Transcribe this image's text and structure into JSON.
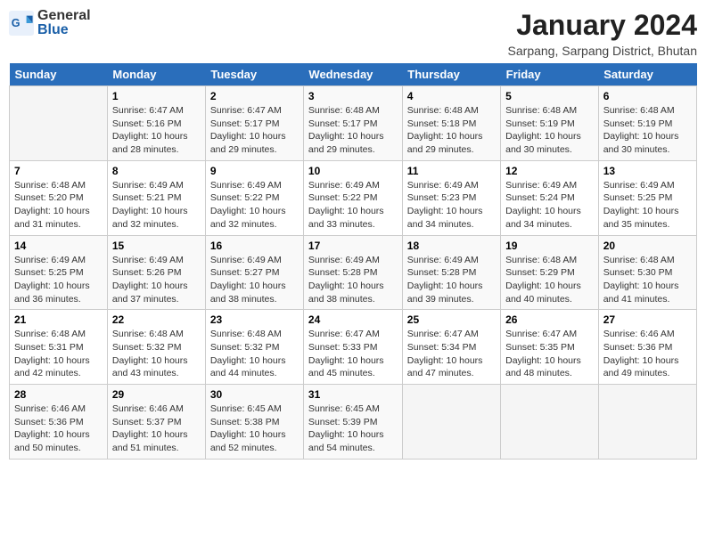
{
  "header": {
    "logo_general": "General",
    "logo_blue": "Blue",
    "month_year": "January 2024",
    "location": "Sarpang, Sarpang District, Bhutan"
  },
  "weekdays": [
    "Sunday",
    "Monday",
    "Tuesday",
    "Wednesday",
    "Thursday",
    "Friday",
    "Saturday"
  ],
  "weeks": [
    [
      {
        "day": "",
        "info": ""
      },
      {
        "day": "1",
        "info": "Sunrise: 6:47 AM\nSunset: 5:16 PM\nDaylight: 10 hours and 28 minutes."
      },
      {
        "day": "2",
        "info": "Sunrise: 6:47 AM\nSunset: 5:17 PM\nDaylight: 10 hours and 29 minutes."
      },
      {
        "day": "3",
        "info": "Sunrise: 6:48 AM\nSunset: 5:17 PM\nDaylight: 10 hours and 29 minutes."
      },
      {
        "day": "4",
        "info": "Sunrise: 6:48 AM\nSunset: 5:18 PM\nDaylight: 10 hours and 29 minutes."
      },
      {
        "day": "5",
        "info": "Sunrise: 6:48 AM\nSunset: 5:19 PM\nDaylight: 10 hours and 30 minutes."
      },
      {
        "day": "6",
        "info": "Sunrise: 6:48 AM\nSunset: 5:19 PM\nDaylight: 10 hours and 30 minutes."
      }
    ],
    [
      {
        "day": "7",
        "info": "Sunrise: 6:48 AM\nSunset: 5:20 PM\nDaylight: 10 hours and 31 minutes."
      },
      {
        "day": "8",
        "info": "Sunrise: 6:49 AM\nSunset: 5:21 PM\nDaylight: 10 hours and 32 minutes."
      },
      {
        "day": "9",
        "info": "Sunrise: 6:49 AM\nSunset: 5:22 PM\nDaylight: 10 hours and 32 minutes."
      },
      {
        "day": "10",
        "info": "Sunrise: 6:49 AM\nSunset: 5:22 PM\nDaylight: 10 hours and 33 minutes."
      },
      {
        "day": "11",
        "info": "Sunrise: 6:49 AM\nSunset: 5:23 PM\nDaylight: 10 hours and 34 minutes."
      },
      {
        "day": "12",
        "info": "Sunrise: 6:49 AM\nSunset: 5:24 PM\nDaylight: 10 hours and 34 minutes."
      },
      {
        "day": "13",
        "info": "Sunrise: 6:49 AM\nSunset: 5:25 PM\nDaylight: 10 hours and 35 minutes."
      }
    ],
    [
      {
        "day": "14",
        "info": "Sunrise: 6:49 AM\nSunset: 5:25 PM\nDaylight: 10 hours and 36 minutes."
      },
      {
        "day": "15",
        "info": "Sunrise: 6:49 AM\nSunset: 5:26 PM\nDaylight: 10 hours and 37 minutes."
      },
      {
        "day": "16",
        "info": "Sunrise: 6:49 AM\nSunset: 5:27 PM\nDaylight: 10 hours and 38 minutes."
      },
      {
        "day": "17",
        "info": "Sunrise: 6:49 AM\nSunset: 5:28 PM\nDaylight: 10 hours and 38 minutes."
      },
      {
        "day": "18",
        "info": "Sunrise: 6:49 AM\nSunset: 5:28 PM\nDaylight: 10 hours and 39 minutes."
      },
      {
        "day": "19",
        "info": "Sunrise: 6:48 AM\nSunset: 5:29 PM\nDaylight: 10 hours and 40 minutes."
      },
      {
        "day": "20",
        "info": "Sunrise: 6:48 AM\nSunset: 5:30 PM\nDaylight: 10 hours and 41 minutes."
      }
    ],
    [
      {
        "day": "21",
        "info": "Sunrise: 6:48 AM\nSunset: 5:31 PM\nDaylight: 10 hours and 42 minutes."
      },
      {
        "day": "22",
        "info": "Sunrise: 6:48 AM\nSunset: 5:32 PM\nDaylight: 10 hours and 43 minutes."
      },
      {
        "day": "23",
        "info": "Sunrise: 6:48 AM\nSunset: 5:32 PM\nDaylight: 10 hours and 44 minutes."
      },
      {
        "day": "24",
        "info": "Sunrise: 6:47 AM\nSunset: 5:33 PM\nDaylight: 10 hours and 45 minutes."
      },
      {
        "day": "25",
        "info": "Sunrise: 6:47 AM\nSunset: 5:34 PM\nDaylight: 10 hours and 47 minutes."
      },
      {
        "day": "26",
        "info": "Sunrise: 6:47 AM\nSunset: 5:35 PM\nDaylight: 10 hours and 48 minutes."
      },
      {
        "day": "27",
        "info": "Sunrise: 6:46 AM\nSunset: 5:36 PM\nDaylight: 10 hours and 49 minutes."
      }
    ],
    [
      {
        "day": "28",
        "info": "Sunrise: 6:46 AM\nSunset: 5:36 PM\nDaylight: 10 hours and 50 minutes."
      },
      {
        "day": "29",
        "info": "Sunrise: 6:46 AM\nSunset: 5:37 PM\nDaylight: 10 hours and 51 minutes."
      },
      {
        "day": "30",
        "info": "Sunrise: 6:45 AM\nSunset: 5:38 PM\nDaylight: 10 hours and 52 minutes."
      },
      {
        "day": "31",
        "info": "Sunrise: 6:45 AM\nSunset: 5:39 PM\nDaylight: 10 hours and 54 minutes."
      },
      {
        "day": "",
        "info": ""
      },
      {
        "day": "",
        "info": ""
      },
      {
        "day": "",
        "info": ""
      }
    ]
  ]
}
